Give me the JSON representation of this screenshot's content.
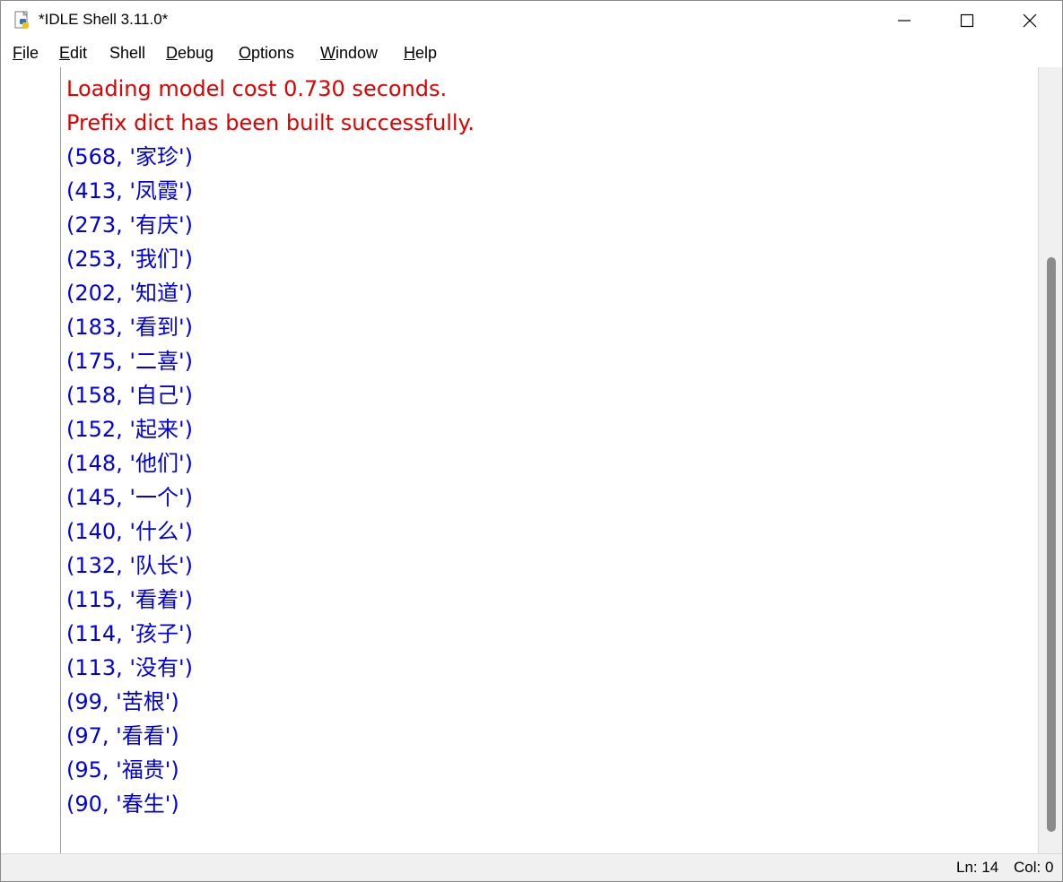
{
  "window": {
    "title": "*IDLE Shell 3.11.0*"
  },
  "menu": [
    {
      "label_underline": "F",
      "label_rest": "ile"
    },
    {
      "label_underline": "E",
      "label_rest": "dit"
    },
    {
      "label_underline": "",
      "label_rest": "Shell"
    },
    {
      "label_underline": "D",
      "label_rest": "ebug"
    },
    {
      "label_underline": "O",
      "label_rest": "ptions"
    },
    {
      "label_underline": "W",
      "label_rest": "indow"
    },
    {
      "label_underline": "H",
      "label_rest": "elp"
    }
  ],
  "output": {
    "stderr_lines": [
      "Loading model cost 0.730 seconds.",
      "Prefix dict has been built successfully."
    ],
    "stdout_lines": [
      "(568, '家珍')",
      "(413, '凤霞')",
      "(273, '有庆')",
      "(253, '我们')",
      "(202, '知道')",
      "(183, '看到')",
      "(175, '二喜')",
      "(158, '自己')",
      "(152, '起来')",
      "(148, '他们')",
      "(145, '一个')",
      "(140, '什么')",
      "(132, '队长')",
      "(115, '看着')",
      "(114, '孩子')",
      "(113, '没有')",
      "(99, '苦根')",
      "(97, '看看')",
      "(95, '福贵')",
      "(90, '春生')"
    ]
  },
  "status": {
    "ln": "Ln: 14",
    "col": "Col: 0"
  },
  "colors": {
    "stderr": "#e00000",
    "stdout": "#0000e0"
  }
}
